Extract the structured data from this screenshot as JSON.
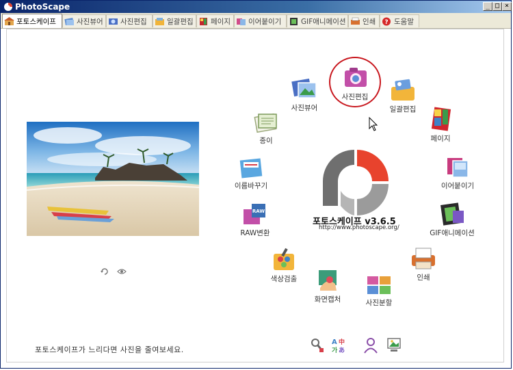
{
  "window": {
    "title": "PhotoScape",
    "buttons": {
      "minimize": "_",
      "maximize": "□",
      "close": "×"
    }
  },
  "tabs": [
    {
      "label": "포토스케이프",
      "active": true
    },
    {
      "label": "사진뷰어"
    },
    {
      "label": "사진편집"
    },
    {
      "label": "일괄편집"
    },
    {
      "label": "페이지"
    },
    {
      "label": "이어붙이기"
    },
    {
      "label": "GIF애니메이션"
    },
    {
      "label": "인쇄"
    },
    {
      "label": "도움말"
    }
  ],
  "menu": {
    "editor": "사진편집",
    "batch": "일괄편집",
    "page": "페이지",
    "combine": "이어붙이기",
    "gif": "GIF애니메이션",
    "print": "인쇄",
    "splitter": "사진분할",
    "capture": "화면캡처",
    "color_picker": "색상검출",
    "raw": "RAW변환",
    "rename": "이름바꾸기",
    "paper": "종이",
    "viewer": "사진뷰어"
  },
  "brand": {
    "name": "포토스케이프 v3.6.5",
    "url": "http://www.photoscape.org/"
  },
  "status_message": "포토스케이프가 느리다면 사진을 줄여보세요.",
  "colors": {
    "accent_red": "#e8432d",
    "logo_gray": "#8a8a8a",
    "title_bar": "#0a246a",
    "highlight": "#c8161d"
  },
  "icons": {
    "bottom": [
      "tools-icon",
      "language-icon",
      "user-icon",
      "monitor-icon"
    ],
    "photo_controls": [
      "refresh-icon",
      "eye-icon"
    ]
  }
}
